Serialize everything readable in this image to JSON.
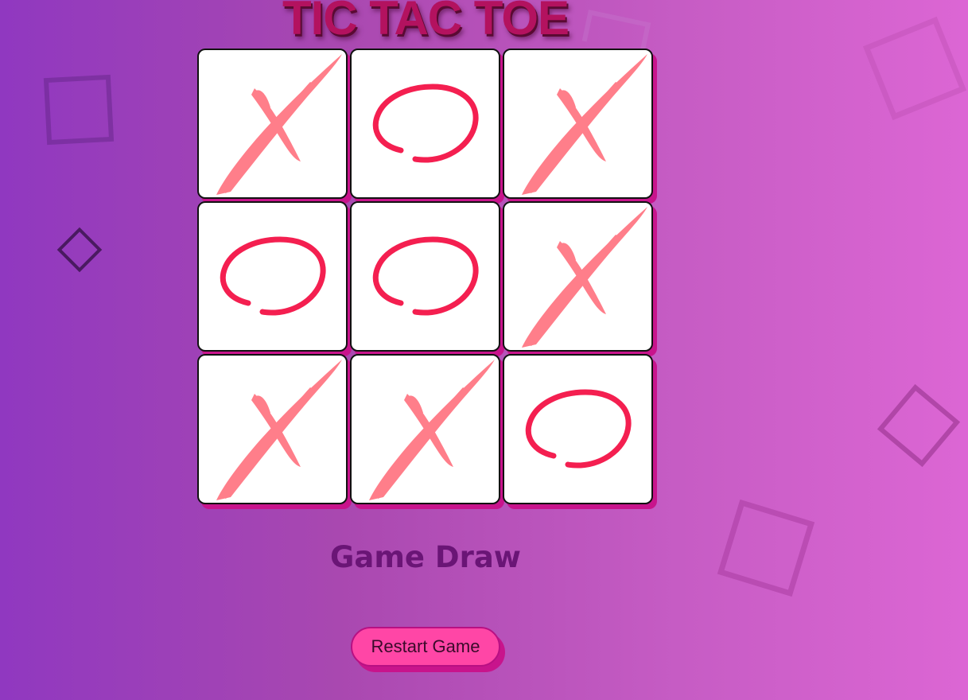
{
  "title": "TIC TAC TOE",
  "status_text": "Game Draw",
  "restart_label": "Restart Game",
  "board": [
    [
      "X",
      "O",
      "X"
    ],
    [
      "O",
      "O",
      "X"
    ],
    [
      "X",
      "X",
      "O"
    ]
  ],
  "colors": {
    "background_start": "#9038c0",
    "background_end": "#dc66d4",
    "title": "#b3125f",
    "title_shadow": "#5a0a33",
    "x_mark": "#ff7e8a",
    "o_mark": "#f41f50",
    "cell_shadow": "#c8148c",
    "status_text": "#6a1576",
    "button_bg": "#ff46a6"
  },
  "icons": {
    "x": "brush-x-icon",
    "o": "circle-o-icon"
  }
}
